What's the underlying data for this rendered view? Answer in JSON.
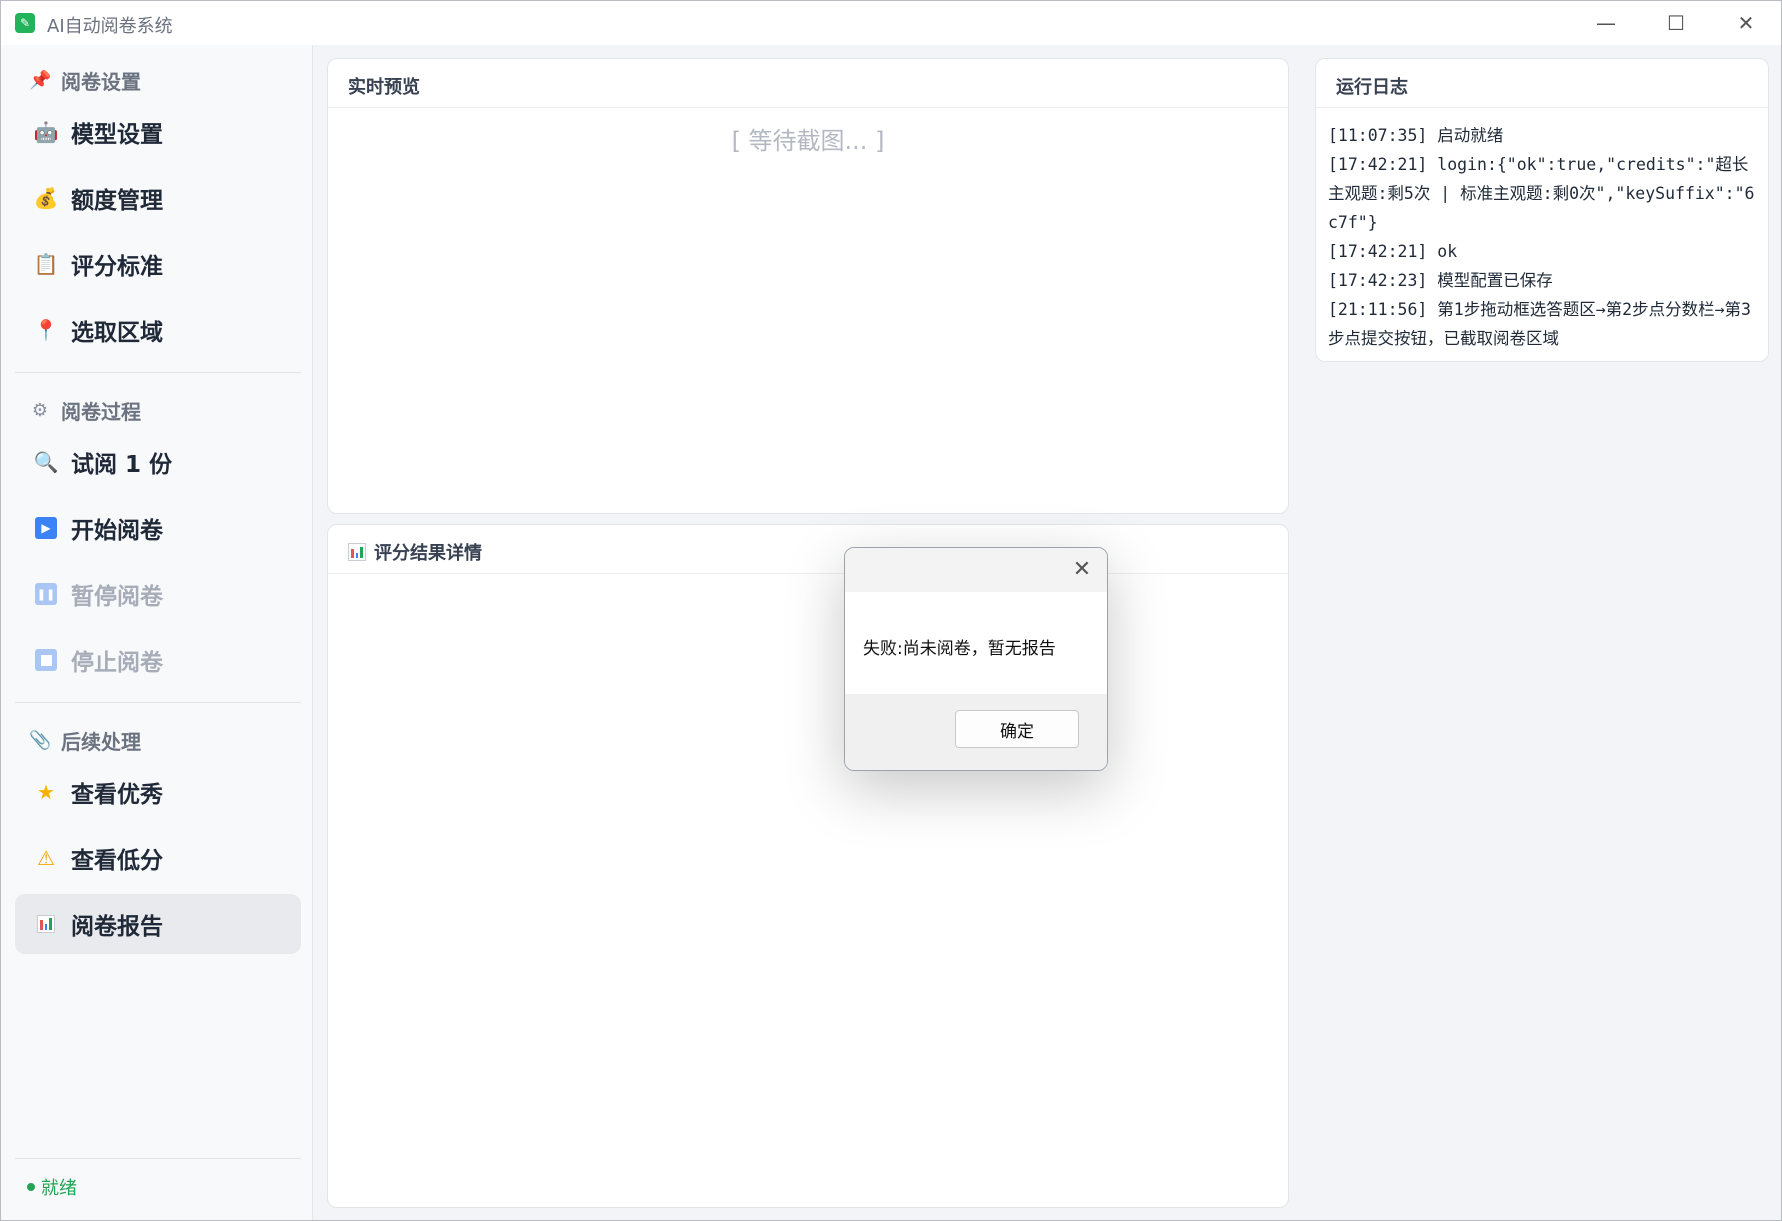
{
  "window": {
    "title": "AI自动阅卷系统",
    "minimize": "—",
    "maximize": "☐",
    "close": "✕"
  },
  "sidebar": {
    "sections": [
      {
        "label": "阅卷设置",
        "icon": "pushpin-icon",
        "items": [
          {
            "label": "模型设置",
            "icon": "robot-icon",
            "enabled": true
          },
          {
            "label": "额度管理",
            "icon": "money-bag-icon",
            "enabled": true
          },
          {
            "label": "评分标准",
            "icon": "clipboard-icon",
            "enabled": true
          },
          {
            "label": "选取区域",
            "icon": "round-pin-icon",
            "enabled": true
          }
        ]
      },
      {
        "label": "阅卷过程",
        "icon": "gear-icon",
        "items": [
          {
            "label": "试阅 1 份",
            "icon": "magnifier-icon",
            "enabled": true
          },
          {
            "label": "开始阅卷",
            "icon": "play-icon",
            "enabled": true
          },
          {
            "label": "暂停阅卷",
            "icon": "pause-icon",
            "enabled": false
          },
          {
            "label": "停止阅卷",
            "icon": "stop-icon",
            "enabled": false
          }
        ]
      },
      {
        "label": "后续处理",
        "icon": "paperclip-icon",
        "items": [
          {
            "label": "查看优秀",
            "icon": "star-icon",
            "enabled": true
          },
          {
            "label": "查看低分",
            "icon": "warning-icon",
            "enabled": true
          },
          {
            "label": "阅卷报告",
            "icon": "bar-chart-icon",
            "enabled": true,
            "active": true
          }
        ]
      }
    ],
    "status": "就绪",
    "status_color": "#22a355"
  },
  "preview": {
    "title": "实时预览",
    "placeholder": "[ 等待截图... ]"
  },
  "results": {
    "title": "评分结果详情"
  },
  "log": {
    "title": "运行日志",
    "lines": [
      "[11:07:35] 启动就绪",
      "[17:42:21] login:{\"ok\":true,\"credits\":\"超长主观题:剩5次 | 标准主观题:剩0次\",\"keySuffix\":\"6c7f\"}",
      "[17:42:21] ok",
      "[17:42:23] 模型配置已保存",
      "[21:11:56] 第1步拖动框选答题区→第2步点分数栏→第3步点提交按钮，已截取阅卷区域"
    ]
  },
  "dialog": {
    "message": "失败:尚未阅卷，暂无报告",
    "ok_label": "确定",
    "close": "✕"
  }
}
